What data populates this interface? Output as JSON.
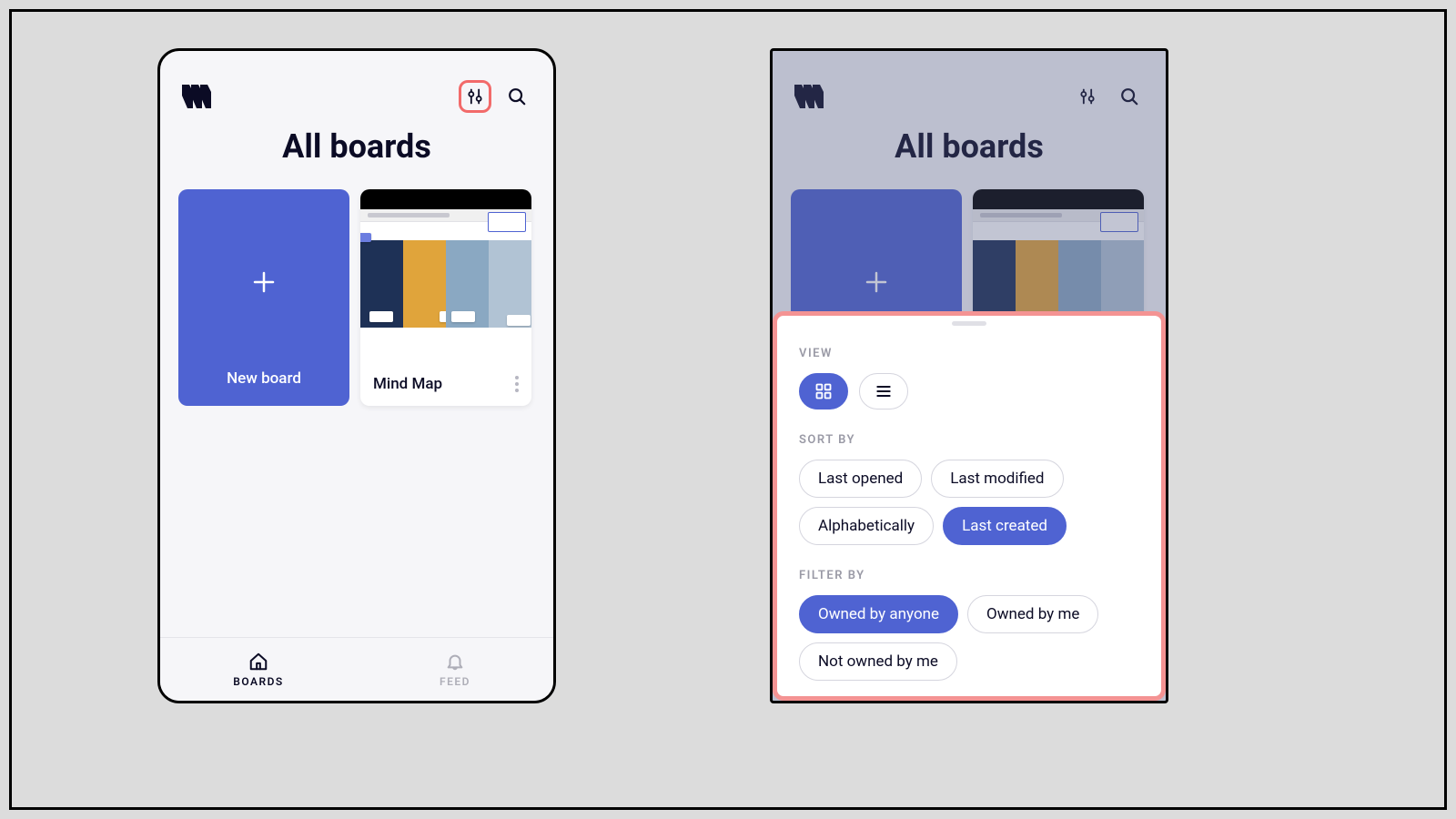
{
  "colors": {
    "accent": "#4f63d2",
    "highlight": "#f49393"
  },
  "left": {
    "title": "All boards",
    "new_board_label": "New board",
    "boards": [
      {
        "name": "Mind Map"
      }
    ],
    "nav": {
      "boards": "BOARDS",
      "feed": "FEED"
    }
  },
  "right": {
    "title": "All boards",
    "sheet": {
      "view_label": "VIEW",
      "view_options": [
        {
          "id": "grid",
          "selected": true
        },
        {
          "id": "list",
          "selected": false
        }
      ],
      "sort_label": "SORT BY",
      "sort_options": [
        {
          "label": "Last opened",
          "selected": false
        },
        {
          "label": "Last modified",
          "selected": false
        },
        {
          "label": "Alphabetically",
          "selected": false
        },
        {
          "label": "Last created",
          "selected": true
        }
      ],
      "filter_label": "FILTER BY",
      "filter_options": [
        {
          "label": "Owned by anyone",
          "selected": true
        },
        {
          "label": "Owned by me",
          "selected": false
        },
        {
          "label": "Not owned by me",
          "selected": false
        }
      ]
    }
  }
}
